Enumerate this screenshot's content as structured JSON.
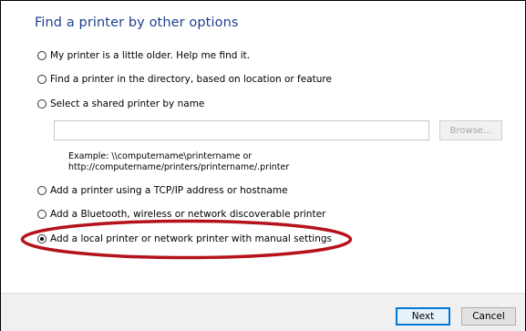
{
  "dialog": {
    "title": "Find a printer by other options"
  },
  "options": [
    {
      "label": "My printer is a little older. Help me find it.",
      "checked": false
    },
    {
      "label": "Find a printer in the directory, based on location or feature",
      "checked": false
    },
    {
      "label": "Select a shared printer by name",
      "checked": false
    },
    {
      "label": "Add a printer using a TCP/IP address or hostname",
      "checked": false
    },
    {
      "label": "Add a Bluetooth, wireless or network discoverable printer",
      "checked": false
    },
    {
      "label": "Add a local printer or network printer with manual settings",
      "checked": true
    }
  ],
  "shared_printer": {
    "input_value": "",
    "browse_label": "Browse...",
    "example_line1": "Example: \\\\computername\\printername or",
    "example_line2": "http://computername/printers/printername/.printer"
  },
  "annotation": {
    "color": "#b5121b"
  },
  "footer": {
    "next_label": "Next",
    "cancel_label": "Cancel"
  }
}
